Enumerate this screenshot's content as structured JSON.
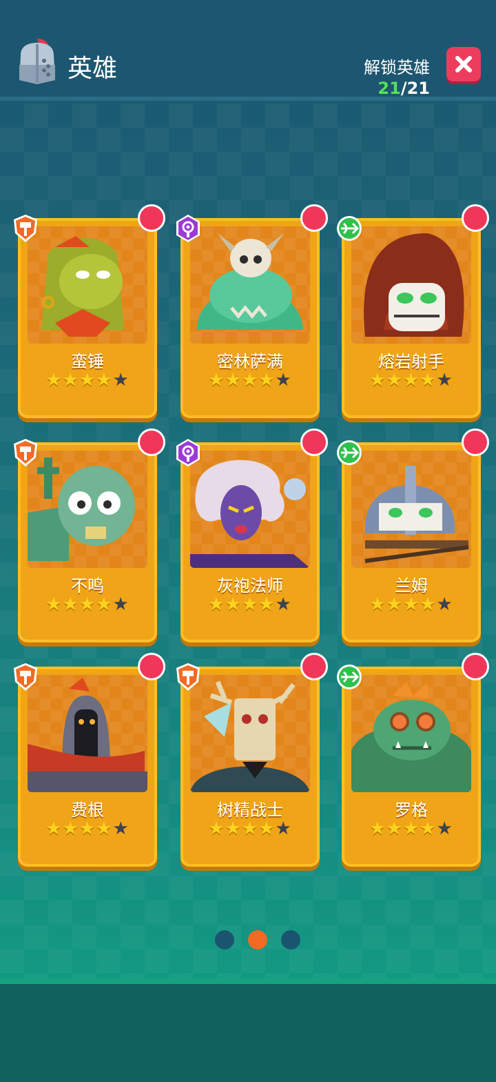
{
  "header": {
    "title": "英雄",
    "unlock_label": "解锁英雄",
    "unlock_current": "21",
    "unlock_total": "/21",
    "close_icon": "close-icon"
  },
  "colors": {
    "card": "#f0a417",
    "notification": "#f0375a",
    "warrior_class": "#f36a23",
    "mage_class": "#9c3ad6",
    "archer_class": "#2ec24a",
    "active_dot": "#f36a23"
  },
  "heroes": [
    {
      "name": "蛮锤",
      "class": "warrior",
      "stars": 4,
      "max_stars": 5,
      "class_icon": "hammer-icon"
    },
    {
      "name": "密林萨满",
      "class": "mage",
      "stars": 4,
      "max_stars": 5,
      "class_icon": "staff-icon"
    },
    {
      "name": "熔岩射手",
      "class": "archer",
      "stars": 4,
      "max_stars": 5,
      "class_icon": "bow-icon"
    },
    {
      "name": "不鸣",
      "class": "warrior",
      "stars": 4,
      "max_stars": 5,
      "class_icon": "hammer-icon"
    },
    {
      "name": "灰袍法师",
      "class": "mage",
      "stars": 4,
      "max_stars": 5,
      "class_icon": "staff-icon"
    },
    {
      "name": "兰姆",
      "class": "archer",
      "stars": 4,
      "max_stars": 5,
      "class_icon": "bow-icon"
    },
    {
      "name": "费根",
      "class": "warrior",
      "stars": 4,
      "max_stars": 5,
      "class_icon": "hammer-icon"
    },
    {
      "name": "树精战士",
      "class": "warrior",
      "stars": 4,
      "max_stars": 5,
      "class_icon": "hammer-icon"
    },
    {
      "name": "罗格",
      "class": "archer",
      "stars": 4,
      "max_stars": 5,
      "class_icon": "bow-icon"
    }
  ],
  "pager": {
    "pages": 3,
    "current": 2
  }
}
